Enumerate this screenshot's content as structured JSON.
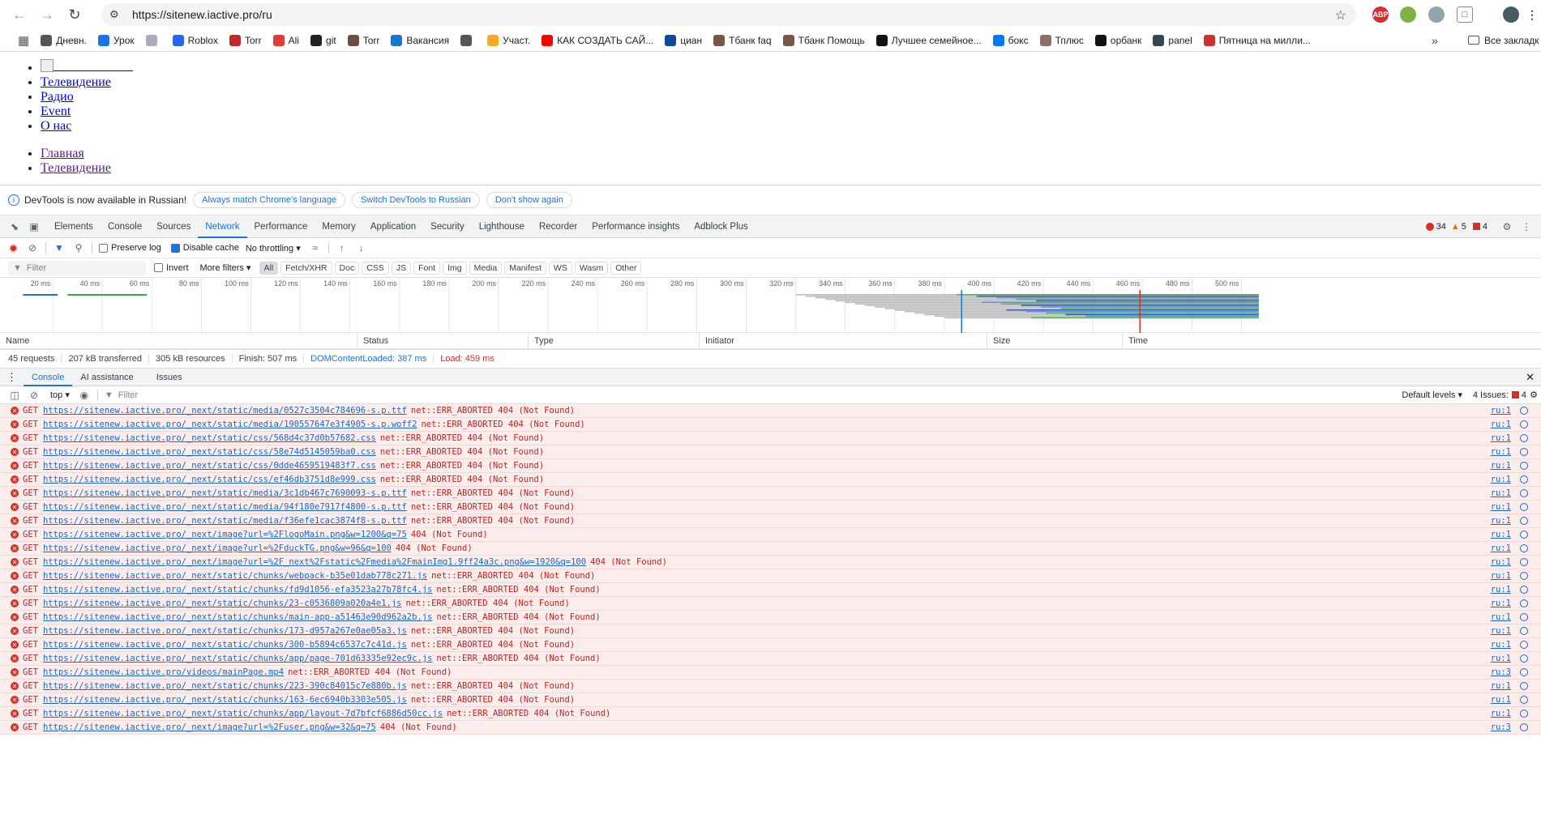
{
  "browser": {
    "url": "https://sitenew.iactive.pro/ru",
    "bookmarks": [
      {
        "label": "Дневн.",
        "color": "#555"
      },
      {
        "label": "Урок",
        "color": "#1a73e8"
      },
      {
        "label": "",
        "color": "#aab"
      },
      {
        "label": "Roblox",
        "color": "#2962ff"
      },
      {
        "label": "Torr",
        "color": "#c62828"
      },
      {
        "label": "Ali",
        "color": "#e53935"
      },
      {
        "label": "git",
        "color": "#222"
      },
      {
        "label": "Torr",
        "color": "#6d4c41"
      },
      {
        "label": "Вакансия",
        "color": "#1976d2"
      },
      {
        "label": "",
        "color": "#555"
      },
      {
        "label": "Участ.",
        "color": "#f9a825"
      },
      {
        "label": "КАК СОЗДАТЬ САЙ...",
        "color": "#ff0000"
      },
      {
        "label": "циан",
        "color": "#0d47a1"
      },
      {
        "label": "Тбанк faq",
        "color": "#795548"
      },
      {
        "label": "Тбанк Помощь",
        "color": "#795548"
      },
      {
        "label": "Лучшее семейное...",
        "color": "#111"
      },
      {
        "label": "бокс",
        "color": "#0077ff"
      },
      {
        "label": "Тплюс",
        "color": "#8d6e63"
      },
      {
        "label": "орбанк",
        "color": "#111"
      },
      {
        "label": "panel",
        "color": "#37474f"
      },
      {
        "label": "Пятница на милли...",
        "color": "#d32f2f"
      }
    ],
    "more_chevron": "»",
    "all_bookmarks": "Все закладк"
  },
  "page": {
    "nav1": [
      "Телевидение",
      "Радио",
      "Event",
      "О нас"
    ],
    "nav2": [
      "Главная",
      "Телевидение"
    ]
  },
  "devtools": {
    "infobar": {
      "text": "DevTools is now available in Russian!",
      "btn1": "Always match Chrome's language",
      "btn2": "Switch DevTools to Russian",
      "btn3": "Don't show again"
    },
    "tabs": [
      "Elements",
      "Console",
      "Sources",
      "Network",
      "Performance",
      "Memory",
      "Application",
      "Security",
      "Lighthouse",
      "Recorder",
      "Performance insights",
      "Adblock Plus"
    ],
    "active_tab": "Network",
    "counts": {
      "errors": "34",
      "warnings": "5",
      "issues": "4"
    },
    "toolbar": {
      "preserve_log": "Preserve log",
      "disable_cache": "Disable cache",
      "throttling": "No throttling"
    },
    "filter": {
      "placeholder": "Filter",
      "invert": "Invert",
      "more_filters": "More filters"
    },
    "types": [
      "All",
      "Fetch/XHR",
      "Doc",
      "CSS",
      "JS",
      "Font",
      "Img",
      "Media",
      "Manifest",
      "WS",
      "Wasm",
      "Other"
    ],
    "timeline_ticks": [
      "20 ms",
      "40 ms",
      "60 ms",
      "80 ms",
      "100 ms",
      "120 ms",
      "140 ms",
      "160 ms",
      "180 ms",
      "200 ms",
      "220 ms",
      "240 ms",
      "260 ms",
      "280 ms",
      "300 ms",
      "320 ms",
      "340 ms",
      "360 ms",
      "380 ms",
      "400 ms",
      "420 ms",
      "440 ms",
      "460 ms",
      "480 ms",
      "500 ms"
    ],
    "columns": [
      "Name",
      "Status",
      "Type",
      "Initiator",
      "Size",
      "Time"
    ],
    "summary": {
      "requests": "45 requests",
      "transferred": "207 kB transferred",
      "resources": "305 kB resources",
      "finish": "Finish: 507 ms",
      "dcl": "DOMContentLoaded: 387 ms",
      "load": "Load: 459 ms"
    },
    "drawer_tabs": [
      "Console",
      "AI assistance",
      "Issues"
    ],
    "console": {
      "context": "top",
      "filter_placeholder": "Filter",
      "levels": "Default levels",
      "issues_label": "4 Issues:",
      "issues_count": "4"
    },
    "log": [
      {
        "url": "https://sitenew.iactive.pro/_next/static/media/0527c3504c784696-s.p.ttf",
        "msg": "net::ERR_ABORTED 404 (Not Found)",
        "src": "ru:1"
      },
      {
        "url": "https://sitenew.iactive.pro/_next/static/media/190557647e3f4905-s.p.woff2",
        "msg": "net::ERR_ABORTED 404 (Not Found)",
        "src": "ru:1"
      },
      {
        "url": "https://sitenew.iactive.pro/_next/static/css/568d4c37d0b57682.css",
        "msg": "net::ERR_ABORTED 404 (Not Found)",
        "src": "ru:1"
      },
      {
        "url": "https://sitenew.iactive.pro/_next/static/css/58e74d5145059ba0.css",
        "msg": "net::ERR_ABORTED 404 (Not Found)",
        "src": "ru:1"
      },
      {
        "url": "https://sitenew.iactive.pro/_next/static/css/0dde4659519483f7.css",
        "msg": "net::ERR_ABORTED 404 (Not Found)",
        "src": "ru:1"
      },
      {
        "url": "https://sitenew.iactive.pro/_next/static/css/ef46db3751d8e999.css",
        "msg": "net::ERR_ABORTED 404 (Not Found)",
        "src": "ru:1"
      },
      {
        "url": "https://sitenew.iactive.pro/_next/static/media/3c1db467c7690093-s.p.ttf",
        "msg": "net::ERR_ABORTED 404 (Not Found)",
        "src": "ru:1"
      },
      {
        "url": "https://sitenew.iactive.pro/_next/static/media/94f180e7917f4800-s.p.ttf",
        "msg": "net::ERR_ABORTED 404 (Not Found)",
        "src": "ru:1"
      },
      {
        "url": "https://sitenew.iactive.pro/_next/static/media/f36efe1cac3874f8-s.p.ttf",
        "msg": "net::ERR_ABORTED 404 (Not Found)",
        "src": "ru:1"
      },
      {
        "url": "https://sitenew.iactive.pro/_next/image?url=%2FlogoMain.png&w=1200&q=75",
        "msg": "404 (Not Found)",
        "src": "ru:1"
      },
      {
        "url": "https://sitenew.iactive.pro/_next/image?url=%2FduckTG.png&w=96&q=100",
        "msg": "404 (Not Found)",
        "src": "ru:1"
      },
      {
        "url": "https://sitenew.iactive.pro/_next/image?url=%2F_next%2Fstatic%2Fmedia%2FmainImg1.9ff24a3c.png&w=1920&q=100",
        "msg": "404 (Not Found)",
        "src": "ru:1"
      },
      {
        "url": "https://sitenew.iactive.pro/_next/static/chunks/webpack-b35e01dab778c271.js",
        "msg": "net::ERR_ABORTED 404 (Not Found)",
        "src": "ru:1"
      },
      {
        "url": "https://sitenew.iactive.pro/_next/static/chunks/fd9d1056-efa3523a27b78fc4.js",
        "msg": "net::ERR_ABORTED 404 (Not Found)",
        "src": "ru:1"
      },
      {
        "url": "https://sitenew.iactive.pro/_next/static/chunks/23-c0536809a020a4e1.js",
        "msg": "net::ERR_ABORTED 404 (Not Found)",
        "src": "ru:1"
      },
      {
        "url": "https://sitenew.iactive.pro/_next/static/chunks/main-app-a51463e90d962a2b.js",
        "msg": "net::ERR_ABORTED 404 (Not Found)",
        "src": "ru:1"
      },
      {
        "url": "https://sitenew.iactive.pro/_next/static/chunks/173-d957a267e0ae05a3.js",
        "msg": "net::ERR_ABORTED 404 (Not Found)",
        "src": "ru:1"
      },
      {
        "url": "https://sitenew.iactive.pro/_next/static/chunks/300-b5894c6537c7c41d.js",
        "msg": "net::ERR_ABORTED 404 (Not Found)",
        "src": "ru:1"
      },
      {
        "url": "https://sitenew.iactive.pro/_next/static/chunks/app/page-701d63335e92ec9c.js",
        "msg": "net::ERR_ABORTED 404 (Not Found)",
        "src": "ru:1"
      },
      {
        "url": "https://sitenew.iactive.pro/videos/mainPage.mp4",
        "msg": "net::ERR_ABORTED 404 (Not Found)",
        "src": "ru:3"
      },
      {
        "url": "https://sitenew.iactive.pro/_next/static/chunks/223-390c84015c7e880b.js",
        "msg": "net::ERR_ABORTED 404 (Not Found)",
        "src": "ru:1"
      },
      {
        "url": "https://sitenew.iactive.pro/_next/static/chunks/163-6ec6940b3303e505.js",
        "msg": "net::ERR_ABORTED 404 (Not Found)",
        "src": "ru:1"
      },
      {
        "url": "https://sitenew.iactive.pro/_next/static/chunks/app/layout-7d7bfcf6886d50cc.js",
        "msg": "net::ERR_ABORTED 404 (Not Found)",
        "src": "ru:1"
      },
      {
        "url": "https://sitenew.iactive.pro/_next/image?url=%2Fuser.png&w=32&q=75",
        "msg": "404 (Not Found)",
        "src": "ru:3"
      }
    ]
  }
}
